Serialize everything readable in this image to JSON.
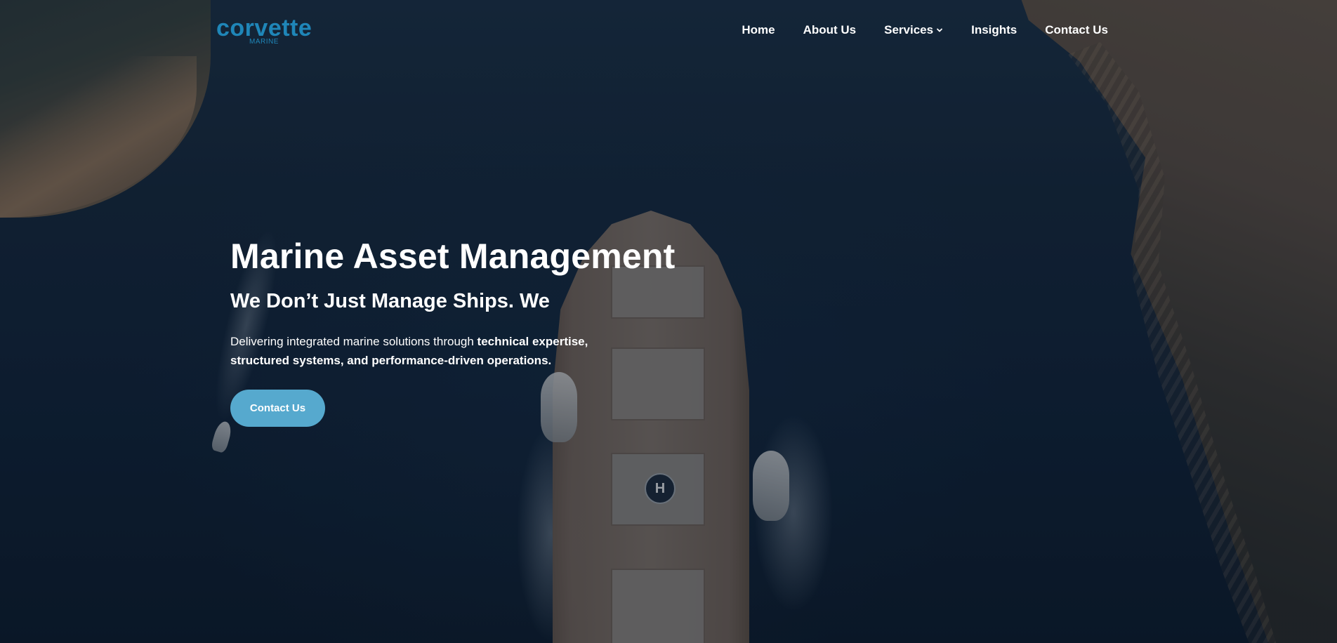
{
  "brand": {
    "name": "corvette",
    "tagline": "MARINE",
    "color": "#1f86b8"
  },
  "nav": {
    "items": [
      {
        "label": "Home"
      },
      {
        "label": "About Us"
      },
      {
        "label": "Services",
        "icon": "chevron-down-icon"
      },
      {
        "label": "Insights"
      },
      {
        "label": "Contact Us"
      }
    ]
  },
  "hero": {
    "title": "Marine Asset Management",
    "subtitle": "We Don’t Just Manage Ships. We",
    "description_plain": "Delivering integrated marine solutions through ",
    "description_strong": "technical expertise, structured systems, and performance-driven operations.",
    "cta_label": "Contact Us",
    "cta_color": "#56a9ce",
    "helipad_letter": "H"
  }
}
